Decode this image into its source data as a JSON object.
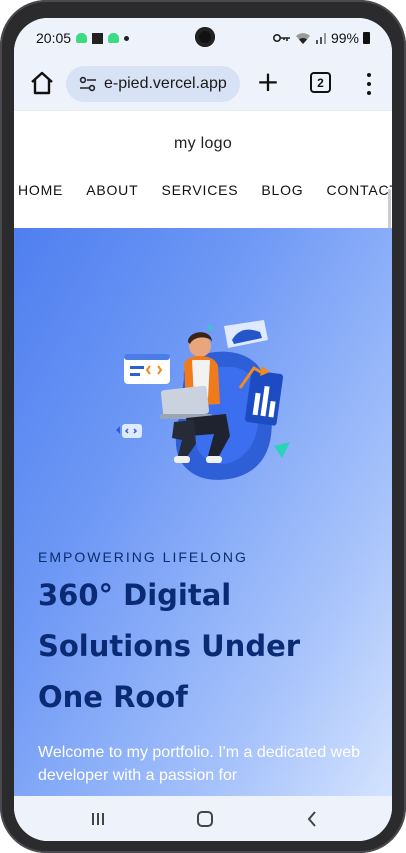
{
  "status_bar": {
    "time": "20:05",
    "battery": "99%",
    "icons": [
      "android-icon",
      "stop-icon",
      "android-icon",
      "dot-icon",
      "key-icon",
      "wifi-icon",
      "signal-icon",
      "battery-icon"
    ]
  },
  "browser": {
    "url": "e-pied.vercel.app",
    "new_tab_label": "+",
    "tab_count": "2"
  },
  "site": {
    "logo": "my logo",
    "nav": [
      "HOME",
      "ABOUT",
      "SERVICES",
      "BLOG",
      "CONTACT"
    ]
  },
  "hero": {
    "eyebrow": "EMPOWERING LIFELONG",
    "title_lines": [
      "360° Digital",
      "Solutions Under",
      "One Roof"
    ],
    "intro": "Welcome to my portfolio. I'm a dedicated web developer with a passion for",
    "colors": {
      "gradient_start": "#4f7ff0",
      "gradient_end": "#d4e3fe",
      "title": "#0a2b73"
    }
  }
}
